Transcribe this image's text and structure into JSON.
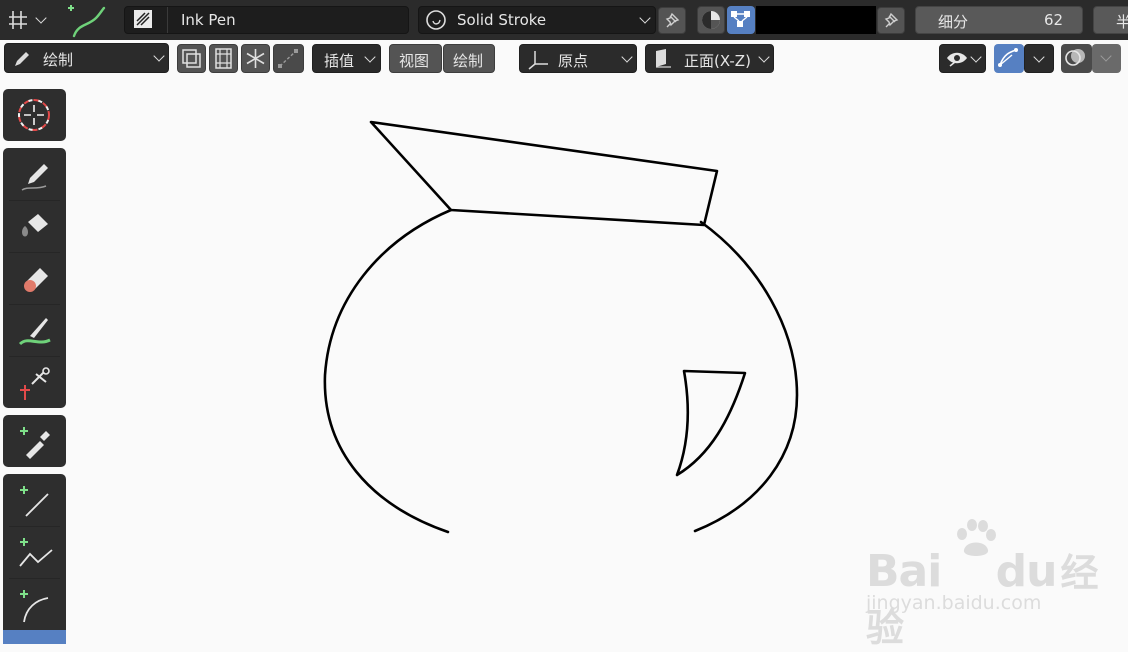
{
  "top": {
    "brush_name": "Ink Pen",
    "material_name": "Solid Stroke",
    "subdivision_label": "细分",
    "subdivision_value": "62",
    "truncated_label": "半",
    "color_swatch": "#000000"
  },
  "header": {
    "mode": "绘制",
    "interp": "插值",
    "view_menu": "视图",
    "draw_menu": "绘制",
    "origin": "原点",
    "plane": "正面(X-Z)"
  },
  "watermark": {
    "brand_a": "Bai",
    "brand_b": "du",
    "brand_cn": "经验",
    "url": "jingyan.baidu.com"
  },
  "colors": {
    "topbar": "#2b2b2b",
    "canvas": "#fafafa",
    "accent_blue": "#5680c2",
    "toolbar": "#2e2e2e"
  }
}
